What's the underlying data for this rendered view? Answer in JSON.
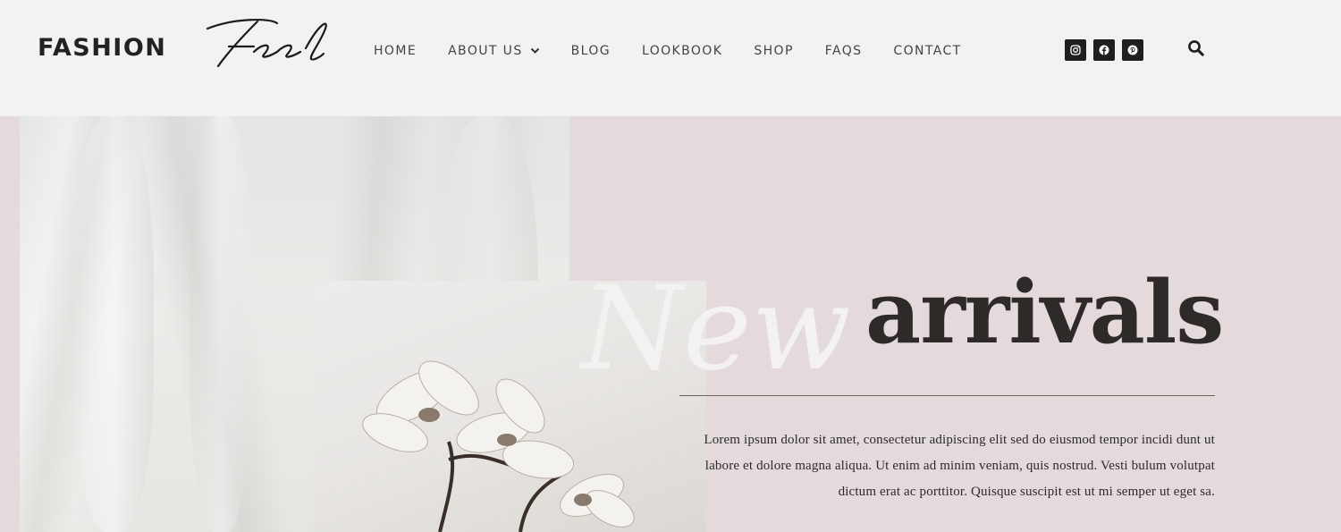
{
  "logo": {
    "word": "FASHION",
    "script": "Feel"
  },
  "nav": {
    "items": [
      {
        "label": "HOME",
        "dropdown": false
      },
      {
        "label": "ABOUT US",
        "dropdown": true
      },
      {
        "label": "BLOG",
        "dropdown": false
      },
      {
        "label": "LOOKBOOK",
        "dropdown": false
      },
      {
        "label": "SHOP",
        "dropdown": false
      },
      {
        "label": "FAQS",
        "dropdown": false
      },
      {
        "label": "CONTACT",
        "dropdown": false
      }
    ]
  },
  "social": {
    "icons": [
      "instagram-icon",
      "facebook-icon",
      "pinterest-icon"
    ]
  },
  "search": {
    "icon": "search-icon"
  },
  "hero": {
    "script_word": "New",
    "title": "arrivals",
    "paragraph": "Lorem ipsum dolor sit amet, consectetur adipiscing elit sed do eiusmod tempor incidi dunt ut labore et dolore magna aliqua. Ut enim ad minim veniam, quis nostrud. Vesti bulum volutpat dictum erat ac porttitor. Quisque suscipit est ut mi semper ut eget sa."
  },
  "colors": {
    "header_bg": "#f2f2f2",
    "hero_bg": "#e5dadb",
    "text_dark": "#2e2a28",
    "icon_bg": "#1f1f1f"
  }
}
